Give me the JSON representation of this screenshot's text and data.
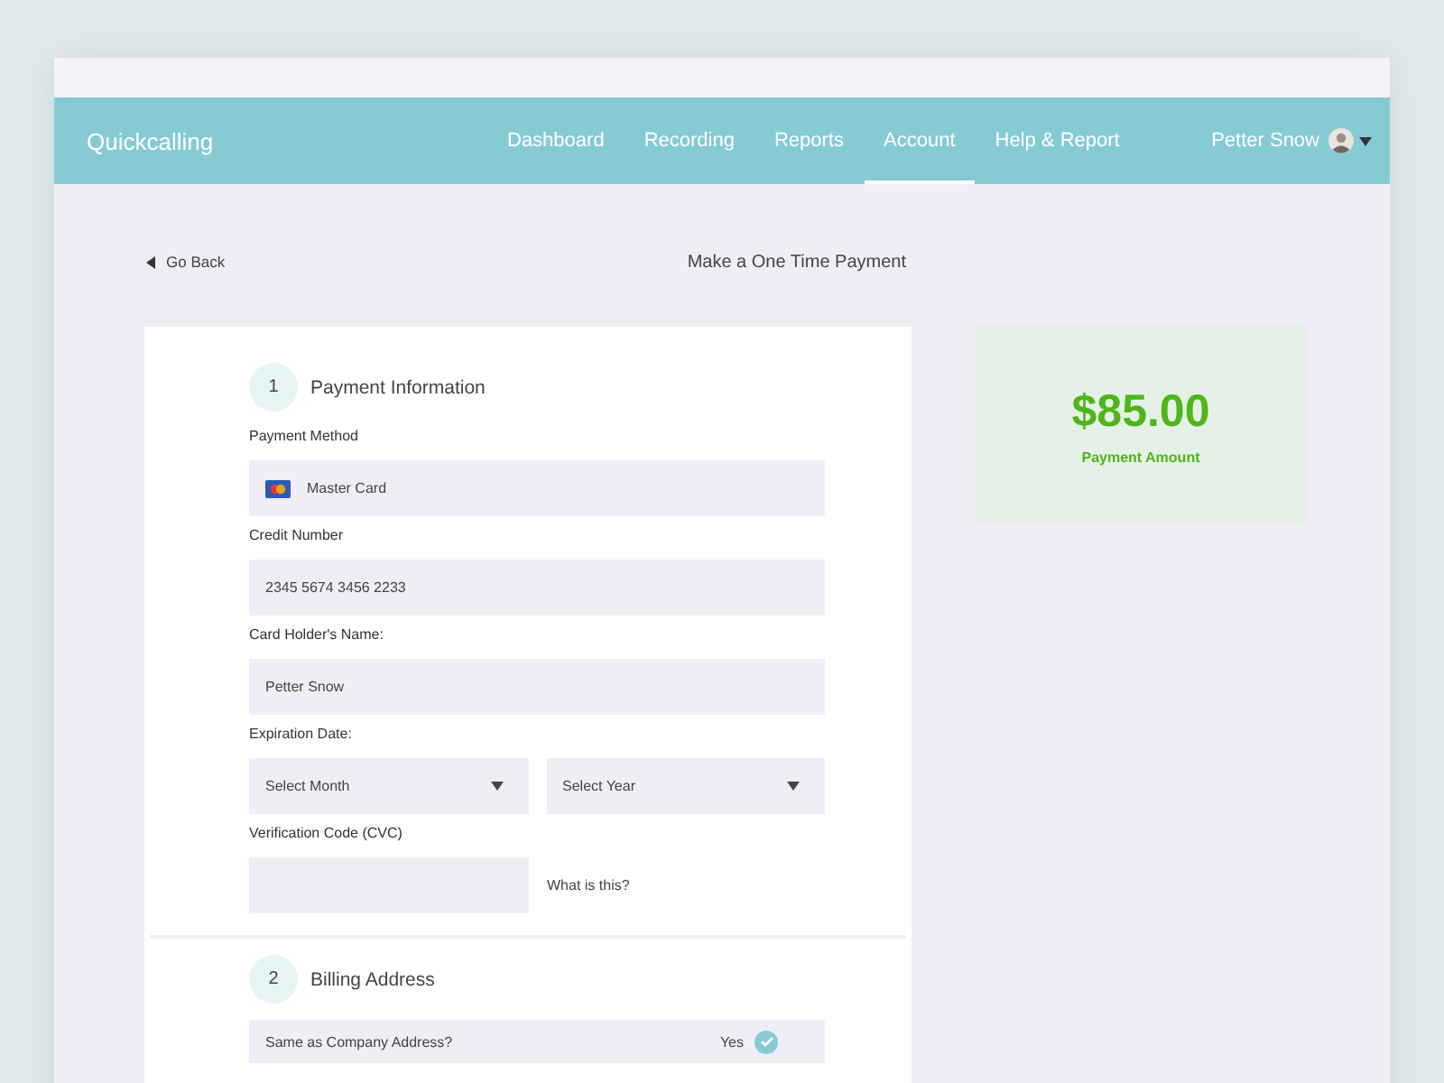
{
  "nav": {
    "brand": "Quickcalling",
    "items": [
      {
        "label": "Dashboard",
        "selected": false
      },
      {
        "label": "Recording",
        "selected": false
      },
      {
        "label": "Reports",
        "selected": false
      },
      {
        "label": "Account",
        "selected": true
      },
      {
        "label": "Help & Report",
        "selected": false
      }
    ],
    "user": "Petter Snow"
  },
  "back": "Go Back",
  "page_title": "Make a One Time Payment",
  "sections": [
    {
      "number": "1",
      "title": "Payment Information",
      "fields": [
        {
          "kind": "card",
          "label": "Payment Method",
          "value": "Master Card"
        },
        {
          "kind": "text",
          "label": "Credit Number",
          "value": "2345 5674 3456 2233"
        },
        {
          "kind": "text",
          "label": "Card Holder's Name:",
          "value": "Petter Snow"
        },
        {
          "kind": "selects",
          "label": "Expiration Date:",
          "options": [
            {
              "placeholder": "Select Month"
            },
            {
              "placeholder": "Select Year"
            }
          ]
        },
        {
          "kind": "cvc",
          "label": "Verification Code (CVC)",
          "help": "What is this?"
        }
      ]
    },
    {
      "number": "2",
      "title": "Billing Address",
      "fields": [
        {
          "kind": "toggle",
          "label": "Same as Company Address?",
          "answer": "Yes",
          "checked": true
        }
      ]
    }
  ],
  "amount": {
    "value": "$85.00",
    "label": "Payment Amount"
  }
}
